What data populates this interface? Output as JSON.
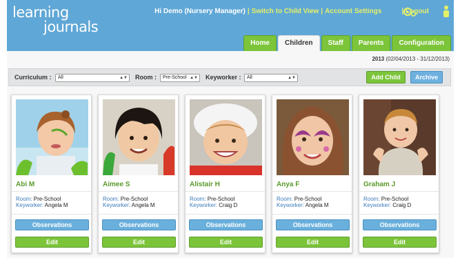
{
  "app": {
    "logo_line1": "learning",
    "logo_line2": "journals"
  },
  "topbar": {
    "greeting": "Hi Demo (Nursery Manager)",
    "switch_link": "Switch to Child View",
    "settings_link": "Account Settings",
    "logout_link": "Logout",
    "separator": "|"
  },
  "tabs": [
    {
      "label": "Home",
      "active": false
    },
    {
      "label": "Children",
      "active": true
    },
    {
      "label": "Staff",
      "active": false
    },
    {
      "label": "Parents",
      "active": false
    },
    {
      "label": "Configuration",
      "active": false
    }
  ],
  "period": {
    "year": "2013",
    "range": "(02/04/2013 - 31/12/2013)"
  },
  "filters": {
    "curriculum_label": "Curriculum :",
    "curriculum_value": "All",
    "room_label": "Room :",
    "room_value": "Pre-School",
    "keyworker_label": "Keyworker :",
    "keyworker_value": "All",
    "add_child": "Add Child",
    "archive": "Archive"
  },
  "labels": {
    "room": "Room:",
    "keyworker": "Keyworker:",
    "observations": "Observations",
    "edit": "Edit"
  },
  "children": [
    {
      "name": "Abi M",
      "room": "Pre-School",
      "keyworker": "Angela M"
    },
    {
      "name": "Aimee S",
      "room": "Pre-School",
      "keyworker": "Angela M"
    },
    {
      "name": "Alistair H",
      "room": "Pre-School",
      "keyworker": "Craig D"
    },
    {
      "name": "Anya F",
      "room": "Pre-School",
      "keyworker": "Angela M"
    },
    {
      "name": "Graham J",
      "room": "Pre-School",
      "keyworker": "Craig D"
    }
  ],
  "colors": {
    "header": "#5fa7d6",
    "accent_green": "#7cc43a",
    "accent_blue": "#6ab0dc",
    "link_yellow": "#e4f06a"
  }
}
